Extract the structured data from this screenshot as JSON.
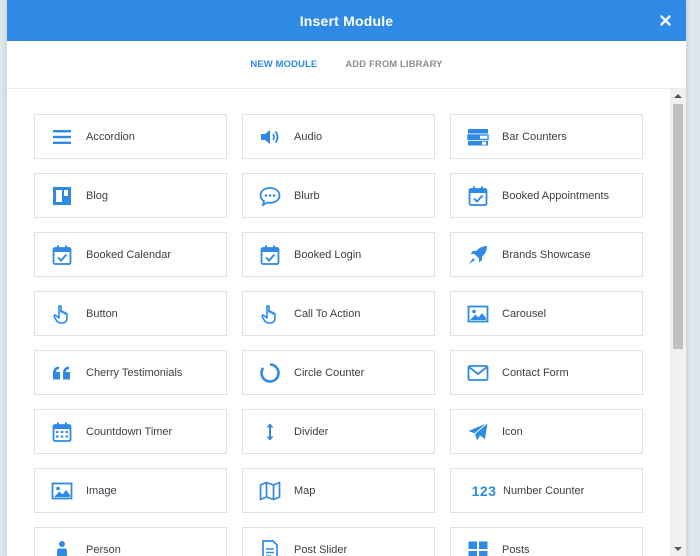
{
  "modal": {
    "title": "Insert Module",
    "close_icon": "close-icon"
  },
  "tabs": [
    {
      "label": "NEW MODULE",
      "active": true
    },
    {
      "label": "ADD FROM LIBRARY",
      "active": false
    }
  ],
  "modules": [
    {
      "label": "Accordion",
      "icon": "accordion-icon"
    },
    {
      "label": "Audio",
      "icon": "audio-icon"
    },
    {
      "label": "Bar Counters",
      "icon": "bar-counters-icon"
    },
    {
      "label": "Blog",
      "icon": "blog-icon"
    },
    {
      "label": "Blurb",
      "icon": "blurb-icon"
    },
    {
      "label": "Booked Appointments",
      "icon": "calendar-check-icon"
    },
    {
      "label": "Booked Calendar",
      "icon": "calendar-check-icon"
    },
    {
      "label": "Booked Login",
      "icon": "calendar-check-icon"
    },
    {
      "label": "Brands Showcase",
      "icon": "rocket-icon"
    },
    {
      "label": "Button",
      "icon": "pointer-hand-icon"
    },
    {
      "label": "Call To Action",
      "icon": "pointer-hand-icon"
    },
    {
      "label": "Carousel",
      "icon": "image-icon"
    },
    {
      "label": "Cherry Testimonials",
      "icon": "quote-icon"
    },
    {
      "label": "Circle Counter",
      "icon": "circle-counter-icon"
    },
    {
      "label": "Contact Form",
      "icon": "envelope-icon"
    },
    {
      "label": "Countdown Timer",
      "icon": "calendar-grid-icon"
    },
    {
      "label": "Divider",
      "icon": "divider-icon"
    },
    {
      "label": "Icon",
      "icon": "paper-plane-icon"
    },
    {
      "label": "Image",
      "icon": "image-icon"
    },
    {
      "label": "Map",
      "icon": "map-icon"
    },
    {
      "label": "Number Counter",
      "icon": "number-counter-icon",
      "icon_text": "123"
    },
    {
      "label": "Person",
      "icon": "person-icon"
    },
    {
      "label": "Post Slider",
      "icon": "document-icon"
    },
    {
      "label": "Posts",
      "icon": "posts-grid-icon"
    }
  ],
  "colors": {
    "accent": "#2f8ae6",
    "text": "#3b4046",
    "muted_tab": "#8a8f94",
    "border": "#dde1e5"
  }
}
